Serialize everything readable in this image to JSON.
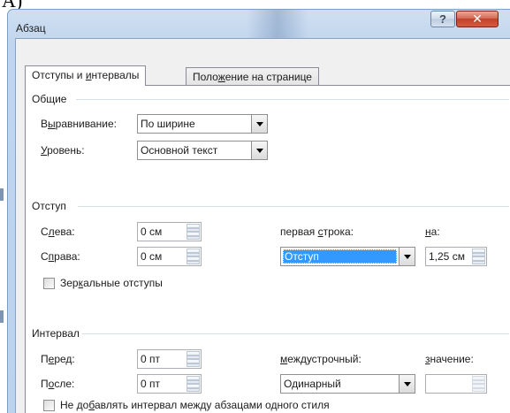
{
  "clipped_label": "A)",
  "dialog": {
    "title": "Абзац",
    "help_label": "?",
    "close_label": "✕"
  },
  "tabs": [
    {
      "pre": "Отступы и ",
      "hot": "и",
      "post": "нтервалы"
    },
    {
      "pre": "Поло",
      "hot": "ж",
      "post": "ение на странице"
    }
  ],
  "general": {
    "title": "Общие",
    "alignment": {
      "pre": "В",
      "hot": "ы",
      "post": "равнивание:",
      "value": "По ширине"
    },
    "level": {
      "pre": "",
      "hot": "У",
      "post": "ровень:",
      "value": "Основной текст"
    }
  },
  "indent": {
    "title": "Отступ",
    "left": {
      "pre": "С",
      "hot": "л",
      "post": "ева:",
      "value": "0 см"
    },
    "right": {
      "pre": "С",
      "hot": "п",
      "post": "рава:",
      "value": "0 см"
    },
    "first_line": {
      "pre": "первая ",
      "hot": "с",
      "post": "трока:",
      "value": "Отступ"
    },
    "by": {
      "pre": "",
      "hot": "н",
      "post": "а:",
      "value": "1,25 см"
    },
    "mirror": {
      "pre": "Зер",
      "hot": "к",
      "post": "альные отступы",
      "checked": false
    }
  },
  "spacing": {
    "title": "Интервал",
    "before": {
      "pre": "П",
      "hot": "е",
      "post": "ред:",
      "value": "0 пт"
    },
    "after": {
      "pre": "П",
      "hot": "о",
      "post": "сле:",
      "value": "0 пт"
    },
    "line_spacing": {
      "pre": "",
      "hot": "м",
      "post": "еждустрочный:",
      "value": "Одинарный"
    },
    "at": {
      "pre": "",
      "hot": "з",
      "post": "начение:",
      "value": ""
    },
    "no_space_same_style": {
      "pre": "Не до",
      "hot": "б",
      "post": "авлять интервал между абзацами одного стиля",
      "checked": false
    }
  },
  "colors": {
    "selection": "#3399ff",
    "close_button": "#c0412a",
    "title_bar": "#c0d5ed"
  }
}
